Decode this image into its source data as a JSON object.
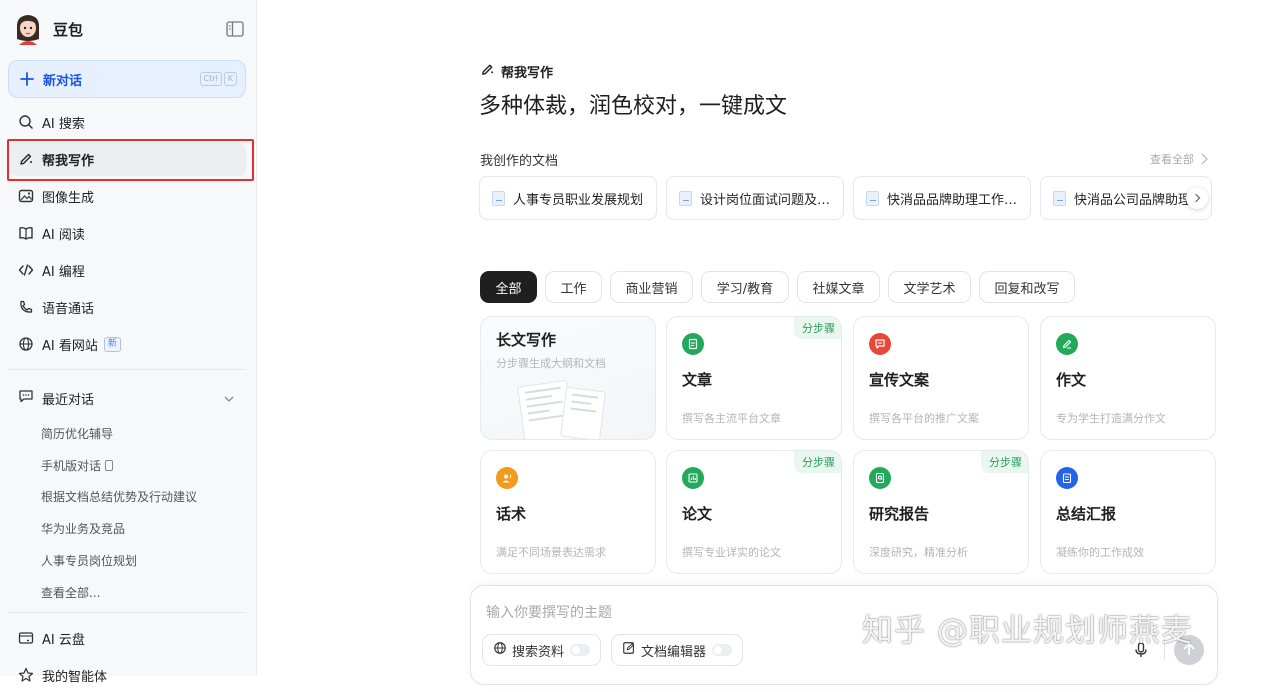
{
  "sidebar": {
    "brand_name": "豆包",
    "new_chat": {
      "label": "新对话",
      "shortcut": [
        "Ctrl",
        "K"
      ]
    },
    "nav": [
      {
        "label": "AI 搜索",
        "icon": "ai-search-icon"
      },
      {
        "label": "帮我写作",
        "icon": "pen-icon",
        "active": true
      },
      {
        "label": "图像生成",
        "icon": "image-icon"
      },
      {
        "label": "AI 阅读",
        "icon": "book-icon"
      },
      {
        "label": "AI 编程",
        "icon": "code-icon"
      },
      {
        "label": "语音通话",
        "icon": "phone-icon"
      },
      {
        "label": "AI 看网站",
        "icon": "globe-icon",
        "badge": "新"
      }
    ],
    "recent": {
      "title": "最近对话",
      "items": [
        "简历优化辅导",
        "手机版对话",
        "根据文档总结优势及行动建议",
        "华为业务及竞品",
        "人事专员岗位规划",
        "查看全部..."
      ]
    },
    "bottom": [
      {
        "label": "AI 云盘",
        "icon": "cloud-drive-icon"
      },
      {
        "label": "我的智能体",
        "icon": "agent-icon"
      }
    ]
  },
  "main": {
    "section_label": "帮我写作",
    "hero": "多种体裁，润色校对，一键成文",
    "docs": {
      "title": "我创作的文档",
      "view_all": "查看全部",
      "items": [
        "人事专员职业发展规划",
        "设计岗位面试问题及…",
        "快消品品牌助理工作…",
        "快消品公司品牌助理"
      ]
    },
    "tabs": [
      "全部",
      "工作",
      "商业营销",
      "学习/教育",
      "社媒文章",
      "文学艺术",
      "回复和改写"
    ],
    "active_tab": "全部",
    "cards": [
      {
        "title": "长文写作",
        "desc": "分步骤生成大纲和文档"
      },
      {
        "title": "文章",
        "desc": "撰写各主流平台文章",
        "tag": "分步骤",
        "color": "#22a95c"
      },
      {
        "title": "宣传文案",
        "desc": "撰写各平台的推广文案",
        "color": "#e8473a"
      },
      {
        "title": "作文",
        "desc": "专为学生打造满分作文",
        "color": "#22a95c"
      },
      {
        "title": "话术",
        "desc": "满足不同场景表达需求",
        "color": "#f39a1a"
      },
      {
        "title": "论文",
        "desc": "撰写专业详实的论文",
        "tag": "分步骤",
        "color": "#22a95c"
      },
      {
        "title": "研究报告",
        "desc": "深度研究，精准分析",
        "tag": "分步骤",
        "color": "#22a95c"
      },
      {
        "title": "总结汇报",
        "desc": "凝练你的工作成效",
        "color": "#2563eb"
      }
    ],
    "composer": {
      "placeholder": "输入你要撰写的主题",
      "tools": [
        "搜索资料",
        "文档编辑器"
      ]
    }
  },
  "watermark": "知乎 @职业规划师燕麦"
}
